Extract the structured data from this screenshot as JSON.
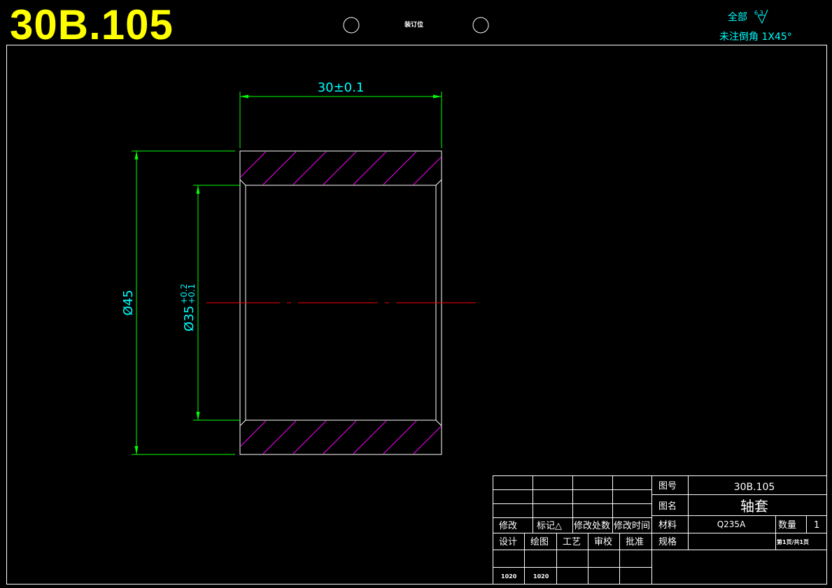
{
  "drawing_number_banner": "30B.105",
  "binding_label": "装订位",
  "surface_note": {
    "all_label": "全部",
    "roughness": "6.3",
    "chamfer_note": "未注倒角 1X45°"
  },
  "dimensions": {
    "length": "30±0.1",
    "outer_diameter": "Ø45",
    "inner_diameter": "Ø35",
    "inner_tol_upper": "+0.2",
    "inner_tol_lower": "+0.1"
  },
  "title_block": {
    "revision_headers": [
      "修改",
      "标记△",
      "修改处数",
      "修改时间"
    ],
    "role_headers": [
      "设计",
      "绘图",
      "工艺",
      "审校",
      "批准"
    ],
    "role_values": [
      "1020",
      "1020",
      "",
      "",
      ""
    ],
    "drawing_no_label": "图号",
    "drawing_no_value": "30B.105",
    "name_label": "图名",
    "name_value": "轴套",
    "material_label": "材料",
    "material_value": "Q235A",
    "qty_label": "数量",
    "qty_value": "1",
    "spec_label": "规格",
    "page_info": "第1页/共1页"
  },
  "colors": {
    "outline": "#ffffff",
    "dimension": "#00ff00",
    "dim_text": "#00ffff",
    "hatch": "#ff00ff",
    "centerline": "#ff0000",
    "banner": "#ffff00"
  }
}
